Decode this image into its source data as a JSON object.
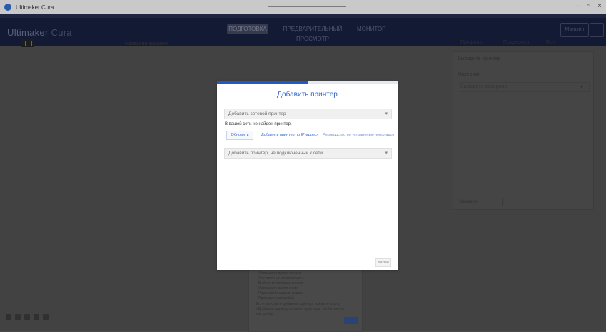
{
  "window": {
    "title": "Ultimaker Cura",
    "minimize": "–",
    "maximize": "▫",
    "close": "×"
  },
  "header": {
    "brand_main": "Ultimaker",
    "brand_sub": "Cura",
    "stages": [
      {
        "label": "ПОДГОТОВКА",
        "active": true
      },
      {
        "label": "ПРЕДВАРИТЕЛЬНЫЙ ПРОСМОТР",
        "active": false
      },
      {
        "label": "МОНИТОР",
        "active": false
      }
    ],
    "marketplace": "Магазин"
  },
  "viewport": {
    "job_name": "Название задания"
  },
  "print_toolbar": {
    "profile": "Профиль",
    "support": "Поддержка",
    "adhesion": "Вкл"
  },
  "right_panel": {
    "printer_label": "Выберите принтер",
    "material_label": "Материал",
    "material_value": "Выберите материал",
    "marketplace_button": "Магазин"
  },
  "log": {
    "lines": [
      "- Уменьшите время печати",
      "- Улучшите качество печати",
      "- Выберите профиль печати",
      "- Уменьшите заполнение",
      "- Разместите модели рядом",
      "- Проверьте настройки",
      "Если вы хотите добавить принтер, нажмите кнопку",
      "«Добавить принтер» в меню принтера, чтобы начать",
      "настройку."
    ]
  },
  "dialog": {
    "title": "Добавить принтер",
    "progress_fraction": 0.5,
    "networked_section": "Добавить сетевой принтер",
    "no_printers": "В вашей сети не найден принтер.",
    "refresh_button": "Обновить",
    "add_by_ip": "Добавить принтер по IP-адресу",
    "troubleshoot": "Руководство по устранению неполадок",
    "local_section": "Добавить принтер, не подключенный к сети",
    "next_button": "Далее"
  },
  "colors": {
    "accent": "#2f66cf",
    "header_bg": "#0c1639",
    "viewport_bg": "#4b4b4b"
  }
}
